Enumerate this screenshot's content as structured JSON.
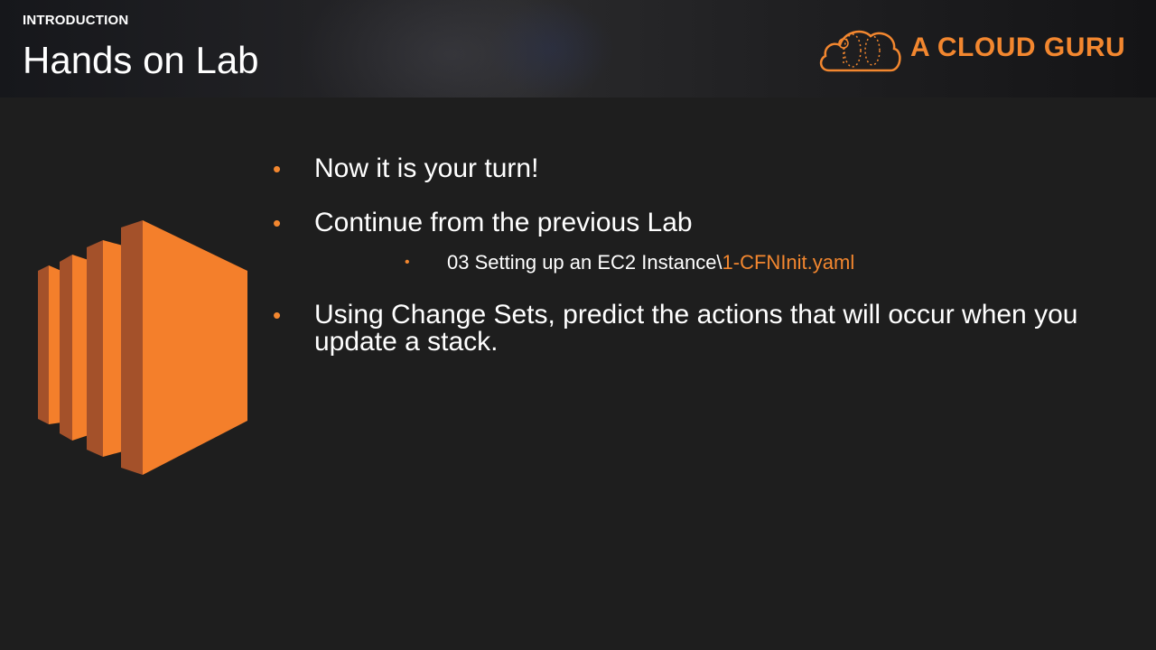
{
  "header": {
    "section_label": "INTRODUCTION",
    "title": "Hands on Lab",
    "logo_text": "A CLOUD GURU"
  },
  "content": {
    "bullets": [
      "Now it is your turn!",
      "Continue from the previous Lab",
      "Using Change Sets, predict the actions that will occur when you update a stack."
    ],
    "sub_bullet": {
      "prefix": "03 Setting up an EC2 Instance\\",
      "highlight": "1-CFNInit.yaml"
    }
  },
  "colors": {
    "accent": "#f3872f",
    "background": "#1e1e1e",
    "text": "#ffffff"
  },
  "icons": {
    "logo": "cloud-logo-icon",
    "main": "ec2-instance-icon",
    "bullet": "bullet-dot-icon"
  }
}
